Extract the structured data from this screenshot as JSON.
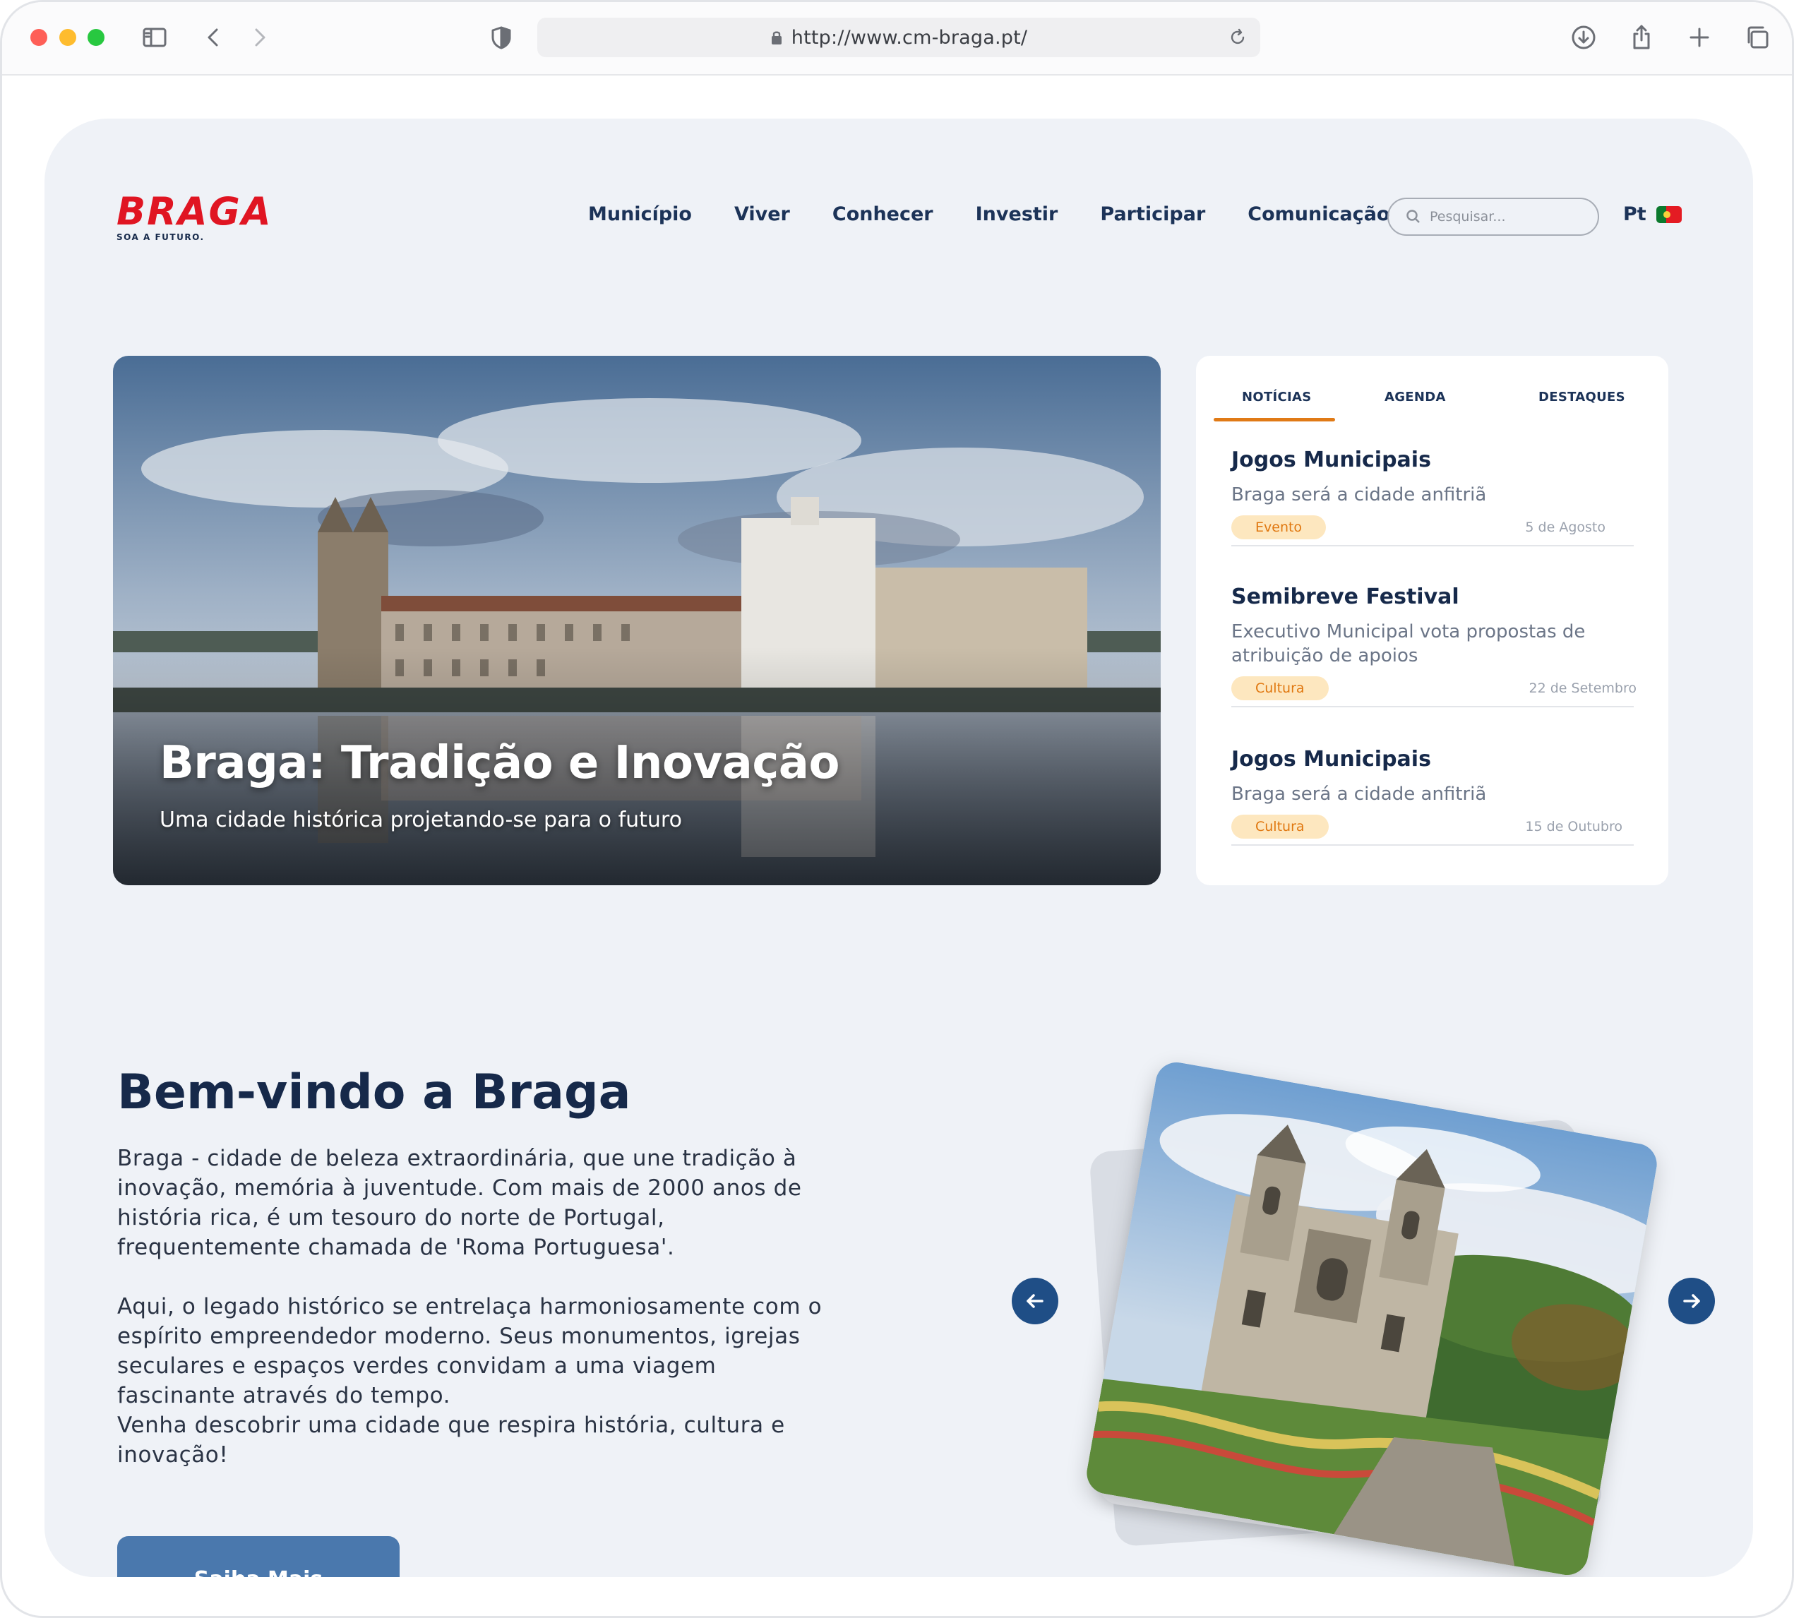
{
  "browser": {
    "url": "http://www.cm-braga.pt/"
  },
  "header": {
    "logo_word": "BRAGA",
    "logo_tagline": "SOA A FUTURO.",
    "nav": [
      "Município",
      "Viver",
      "Conhecer",
      "Investir",
      "Participar",
      "Comunicação"
    ],
    "search_placeholder": "Pesquisar...",
    "language": "Pt"
  },
  "hero": {
    "title": "Braga: Tradição e Inovação",
    "subtitle": "Uma cidade histórica projetando-se para o futuro"
  },
  "news_panel": {
    "tabs": [
      "NOTÍCIAS",
      "AGENDA",
      "DESTAQUES"
    ],
    "active_tab": "NOTÍCIAS",
    "items": [
      {
        "title": "Jogos Municipais",
        "description": "Braga será a cidade anfitriã",
        "badge": "Evento",
        "date": "5 de Agosto"
      },
      {
        "title": "Semibreve Festival",
        "description": "Executivo Municipal vota propostas de atribuição de apoios",
        "badge": "Cultura",
        "date": "22 de Setembro"
      },
      {
        "title": "Jogos Municipais",
        "description": "Braga será a cidade anfitriã",
        "badge": "Cultura",
        "date": "15 de Outubro"
      }
    ]
  },
  "welcome": {
    "title": "Bem-vindo a Braga",
    "paragraph_1": "Braga - cidade de beleza extraordinária, que une tradição à inovação, memória à juventude. Com mais de 2000 anos de história rica, é um tesouro do norte de Portugal, frequentemente chamada de 'Roma Portuguesa'.",
    "paragraph_2": "Aqui, o legado histórico se entrelaça harmoniosamente com o espírito empreendedor moderno. Seus monumentos, igrejas seculares e espaços verdes convidam a uma viagem fascinante através do tempo.",
    "paragraph_3": "Venha descobrir uma cidade que respira história, cultura e inovação!",
    "cta_label": "Saiba Mais"
  },
  "colors": {
    "brand_red": "#e01522",
    "navy": "#16294a",
    "accent_orange": "#e07a16",
    "badge_bg": "#fde7bf",
    "button_blue": "#4a78ad",
    "arrow_blue": "#1f4e86",
    "page_bg": "#eff2f7"
  },
  "icons": {
    "sidebar": "sidebar-icon",
    "back": "chevron-left-icon",
    "forward": "chevron-right-icon",
    "shield": "shield-icon",
    "lock": "lock-icon",
    "reload": "reload-icon",
    "download": "download-icon",
    "share": "share-icon",
    "new_tab": "plus-icon",
    "tabs": "tabs-icon",
    "search": "search-icon",
    "prev": "arrow-left-icon",
    "next": "arrow-right-icon"
  }
}
